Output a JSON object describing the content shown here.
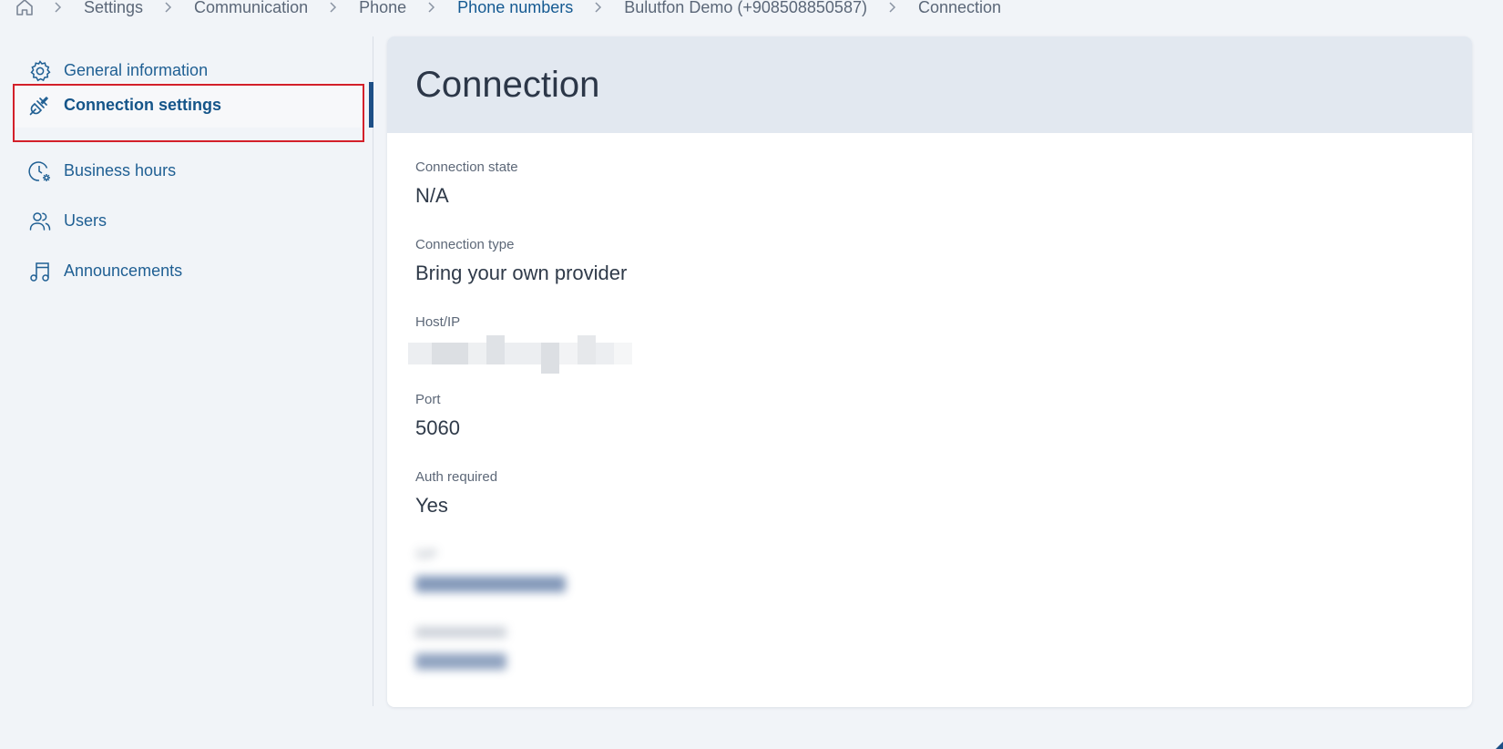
{
  "breadcrumb": {
    "items": [
      {
        "label": "Settings",
        "active": false
      },
      {
        "label": "Communication",
        "active": false
      },
      {
        "label": "Phone",
        "active": false
      },
      {
        "label": "Phone numbers",
        "active": true
      },
      {
        "label": "Bulutfon Demo (+908508850587)",
        "active": false
      },
      {
        "label": "Connection",
        "active": false
      }
    ]
  },
  "sidebar": {
    "items": [
      {
        "label": "General information",
        "icon": "gear-icon",
        "selected": false
      },
      {
        "label": "Connection settings",
        "icon": "plug-icon",
        "selected": true
      },
      {
        "label": "Business hours",
        "icon": "clock-gear-icon",
        "selected": false
      },
      {
        "label": "Users",
        "icon": "users-icon",
        "selected": false
      },
      {
        "label": "Announcements",
        "icon": "music-note-icon",
        "selected": false
      }
    ]
  },
  "main": {
    "title": "Connection",
    "fields": [
      {
        "label": "Connection state",
        "value": "N/A"
      },
      {
        "label": "Connection type",
        "value": "Bring your own provider"
      },
      {
        "label": "Host/IP",
        "value": ""
      },
      {
        "label": "Port",
        "value": "5060"
      },
      {
        "label": "Auth required",
        "value": "Yes"
      },
      {
        "label": "SIP",
        "value": ""
      },
      {
        "label": "",
        "value": ""
      }
    ]
  },
  "colors": {
    "page_background": "#f1f4f8",
    "accent": "#1d4f86",
    "highlight": "#d3202a",
    "header_background": "#e2e8f0"
  }
}
